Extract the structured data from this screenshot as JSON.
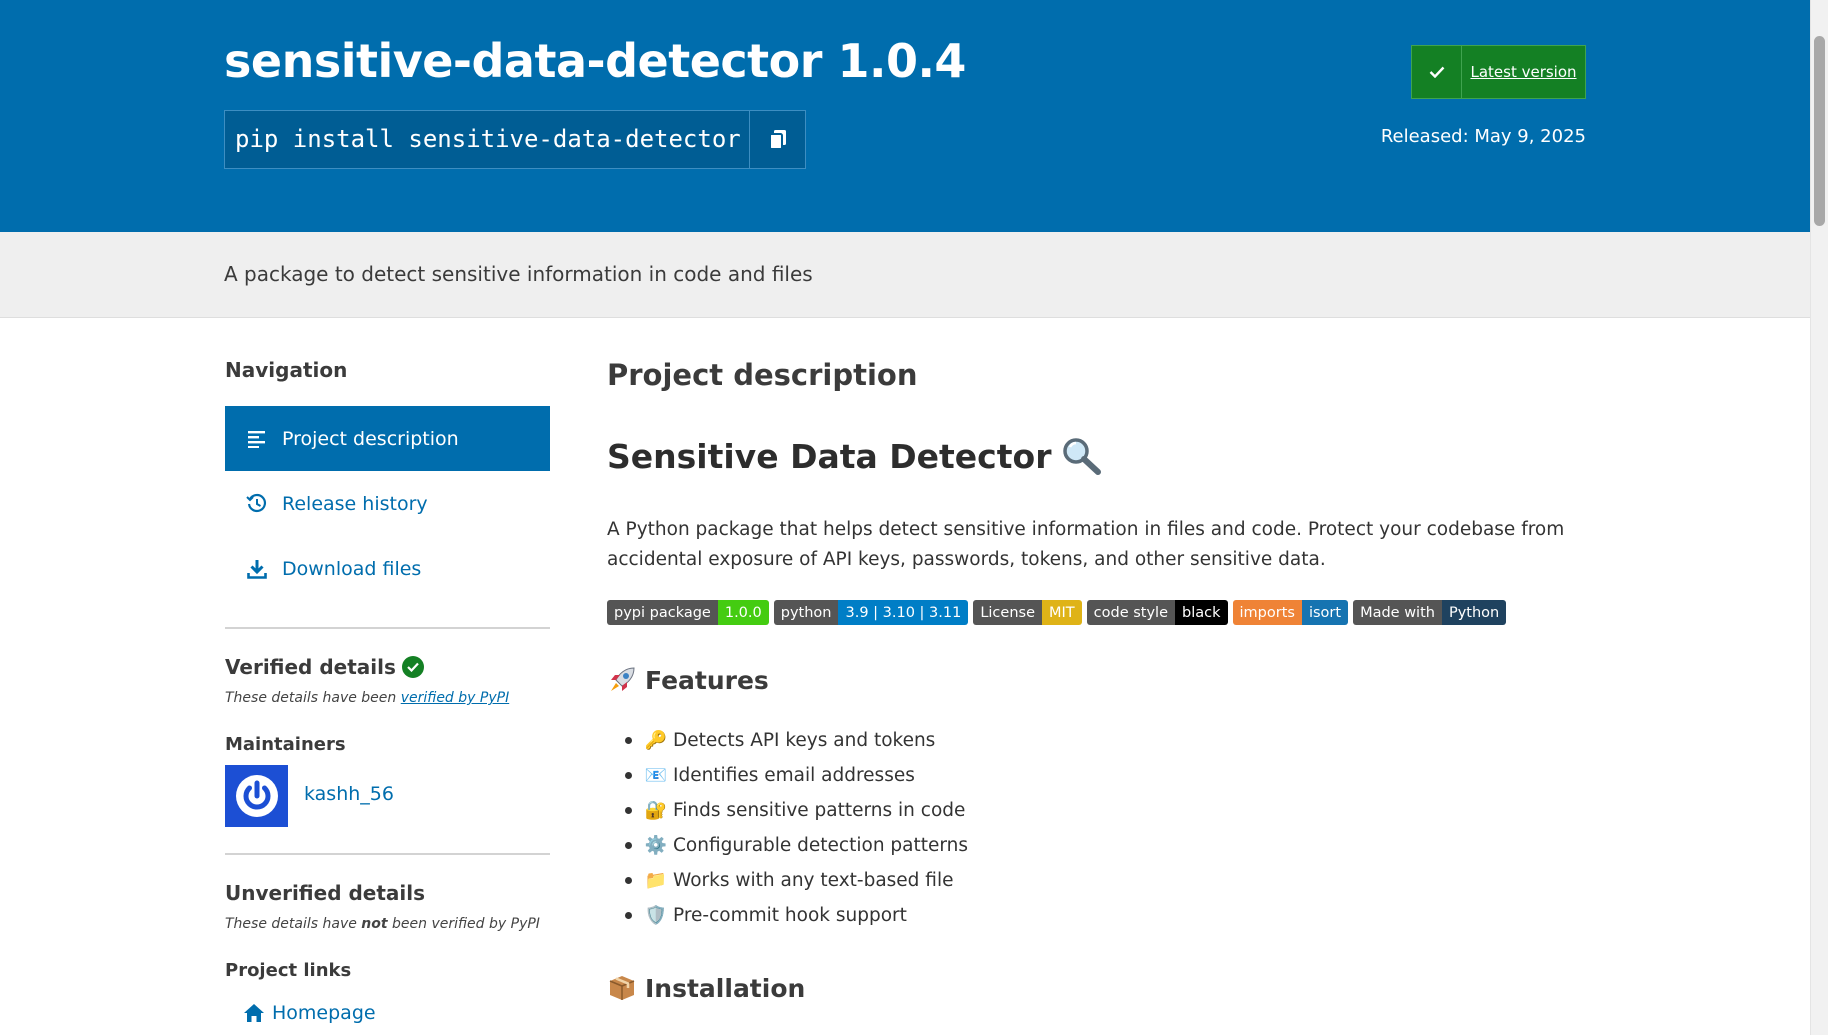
{
  "header": {
    "title": "sensitive-data-detector 1.0.4",
    "pip_command": "pip install sensitive-data-detector",
    "latest_label": "Latest version",
    "released": "Released: May 9, 2025"
  },
  "summary": "A package to detect sensitive information in code and files",
  "sidebar": {
    "navigation_heading": "Navigation",
    "nav_items": [
      {
        "label": "Project description",
        "icon": "align-left-icon"
      },
      {
        "label": "Release history",
        "icon": "history-icon"
      },
      {
        "label": "Download files",
        "icon": "download-icon"
      }
    ],
    "verified_heading": "Verified details",
    "verified_note_prefix": "These details have been",
    "verified_note_link": "verified by PyPI",
    "maintainers_heading": "Maintainers",
    "maintainer_name": "kashh_56",
    "unverified_heading": "Unverified details",
    "unverified_note_prefix": "These details have",
    "unverified_note_bold": "not",
    "unverified_note_suffix": "been verified by PyPI",
    "project_links_heading": "Project links",
    "homepage_label": "Homepage"
  },
  "main": {
    "section_title": "Project description",
    "readme_title": "Sensitive Data Detector",
    "intro": "A Python package that helps detect sensitive information in files and code. Protect your codebase from accidental exposure of API keys, passwords, tokens, and other sensitive data.",
    "badges": [
      {
        "left": "pypi package",
        "right": "1.0.0",
        "color": "#4c1"
      },
      {
        "left": "python",
        "right": "3.9 | 3.10 | 3.11",
        "color": "#007ec6"
      },
      {
        "left": "License",
        "right": "MIT",
        "color": "#dfb317"
      },
      {
        "left": "code style",
        "right": "black",
        "color": "#000000"
      },
      {
        "left": "imports",
        "right": "isort",
        "color": "#1674b1",
        "left_color": "#ef8336"
      },
      {
        "left": "Made with",
        "right": "Python",
        "color": "#1f425f"
      }
    ],
    "features_heading": "Features",
    "features": [
      {
        "emoji": "🔑",
        "text": "Detects API keys and tokens"
      },
      {
        "emoji": "📧",
        "text": "Identifies email addresses"
      },
      {
        "emoji": "🔐",
        "text": "Finds sensitive patterns in code"
      },
      {
        "emoji": "⚙️",
        "text": "Configurable detection patterns"
      },
      {
        "emoji": "📁",
        "text": "Works with any text-based file"
      },
      {
        "emoji": "🛡️",
        "text": "Pre-commit hook support"
      }
    ],
    "installation_heading": "Installation"
  },
  "colors": {
    "brand_blue": "#006dad",
    "success_green": "#148024"
  }
}
